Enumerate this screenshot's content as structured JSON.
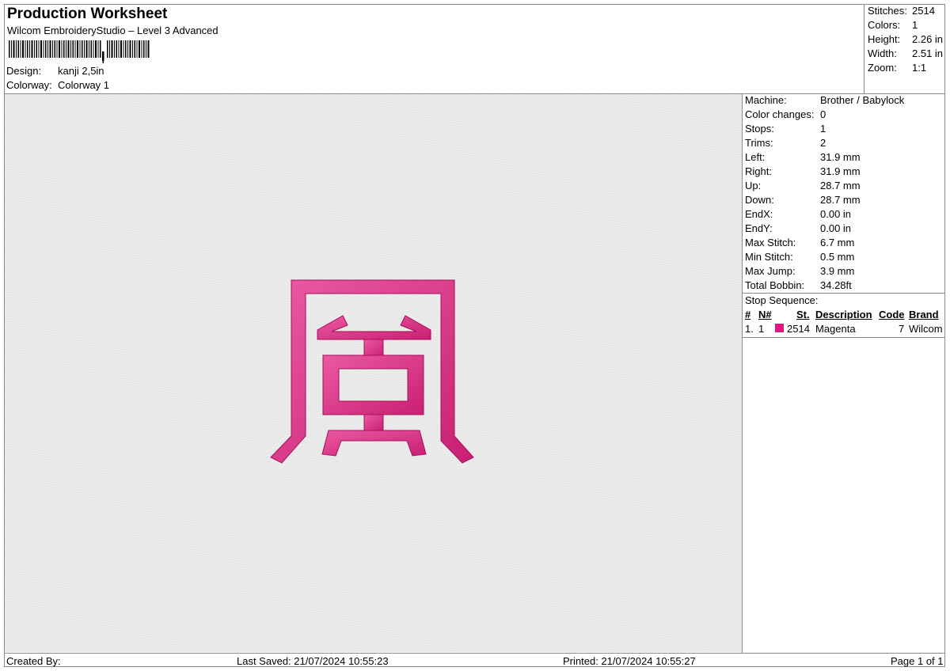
{
  "header": {
    "title": "Production Worksheet",
    "subtitle": "Wilcom EmbroideryStudio – Level 3 Advanced",
    "design_label": "Design:",
    "design_value": "kanji 2,5in",
    "colorway_label": "Colorway:",
    "colorway_value": "Colorway 1"
  },
  "summary": {
    "stitches_label": "Stitches:",
    "stitches": "2514",
    "colors_label": "Colors:",
    "colors": "1",
    "height_label": "Height:",
    "height": "2.26 in",
    "width_label": "Width:",
    "width": "2.51 in",
    "zoom_label": "Zoom:",
    "zoom": "1:1"
  },
  "stats": [
    {
      "label": "Machine:",
      "value": "Brother / Babylock"
    },
    {
      "label": "Color changes:",
      "value": "0"
    },
    {
      "label": "Stops:",
      "value": "1"
    },
    {
      "label": "Trims:",
      "value": "2"
    },
    {
      "label": "Left:",
      "value": "31.9 mm"
    },
    {
      "label": "Right:",
      "value": "31.9 mm"
    },
    {
      "label": "Up:",
      "value": "28.7 mm"
    },
    {
      "label": "Down:",
      "value": "28.7 mm"
    },
    {
      "label": "EndX:",
      "value": "0.00 in"
    },
    {
      "label": "EndY:",
      "value": "0.00 in"
    },
    {
      "label": "Max Stitch:",
      "value": "6.7 mm"
    },
    {
      "label": "Min Stitch:",
      "value": "0.5 mm"
    },
    {
      "label": "Max Jump:",
      "value": "3.9 mm"
    },
    {
      "label": "Total Bobbin:",
      "value": "34.28ft"
    }
  ],
  "stop_sequence": {
    "title": "Stop Sequence:",
    "headers": {
      "num": "#",
      "n": "N#",
      "st": "St.",
      "description": "Description",
      "code": "Code",
      "brand": "Brand"
    },
    "rows": [
      {
        "num": "1.",
        "n": "1",
        "st": "2514",
        "description": "Magenta",
        "code": "7",
        "brand": "Wilcom",
        "color": "#e0167e"
      }
    ]
  },
  "footer": {
    "created_by": "Created By:",
    "last_saved": "Last Saved: 21/07/2024 10:55:23",
    "printed": "Printed: 21/07/2024 10:55:27",
    "page": "Page 1 of 1"
  },
  "colors": {
    "thread": "#e0448f",
    "thread_dark": "#b3125f",
    "border": "#8a8a8a",
    "canvas": "#e7e7e7"
  }
}
